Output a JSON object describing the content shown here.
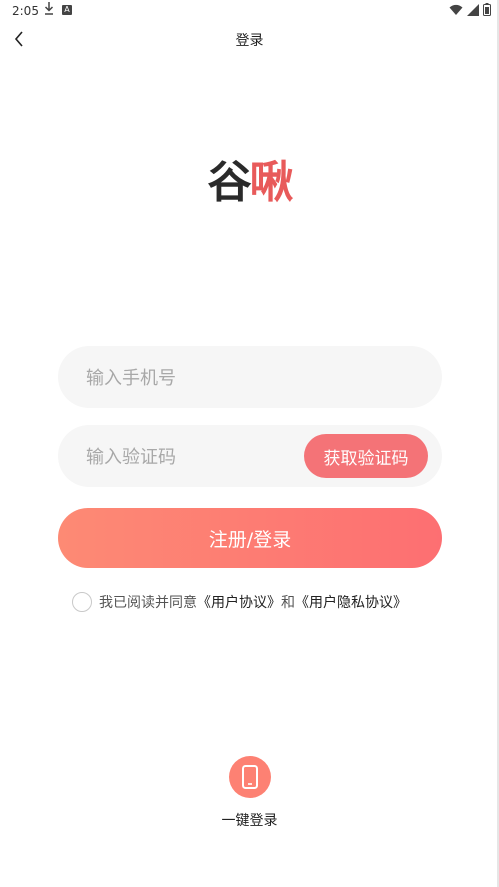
{
  "status_bar": {
    "time": "2:05"
  },
  "header": {
    "title": "登录"
  },
  "logo": {
    "part1": "谷",
    "part2": "啾",
    "accent_color": "#e85a5a"
  },
  "form": {
    "phone_placeholder": "输入手机号",
    "code_placeholder": "输入验证码",
    "get_code_label": "获取验证码",
    "submit_label": "注册/登录"
  },
  "agreement": {
    "text": "我已阅读并同意",
    "user_agreement": "《用户协议》",
    "and": "和",
    "privacy_policy": "《用户隐私协议》"
  },
  "one_tap": {
    "label": "一键登录"
  },
  "colors": {
    "primary": "#fd7172",
    "input_bg": "#f6f6f6",
    "code_button": "#f47377"
  }
}
